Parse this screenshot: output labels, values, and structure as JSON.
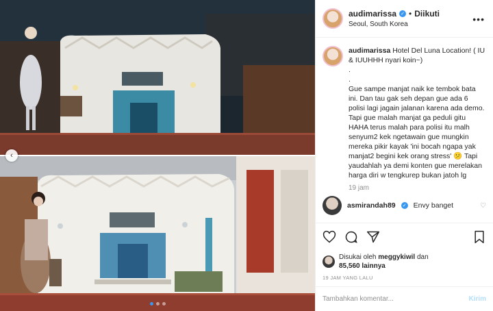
{
  "header": {
    "username": "audimarissa",
    "separator": "•",
    "follow_label": "Diikuti",
    "location": "Seoul, South Korea",
    "more_icon": "more-horizontal-icon"
  },
  "caption": {
    "username": "audimarissa",
    "text": "Hotel Del Luna Location! ( IU & IUUHHH nyari koin~)\n.\n.\nGue sampe manjat naik ke tembok bata ini. Dan tau gak seh depan gue ada 6 polisi lagi jagain jalanan karena ada demo. Tapi gue malah manjat ga peduli gitu HAHA terus malah para polisi itu malh senyum2 kek ngetawain gue mungkin mereka pikir kayak 'ini bocah ngapa yak manjat2 begini kek orang stress' 😕 Tapi yaudahlah ya demi konten gue merelakan harga diri w tengkurep bukan jatoh lg",
    "time": "19 jam"
  },
  "comments": [
    {
      "username": "asmirandah89",
      "text": "Envy banget"
    }
  ],
  "actions": {
    "like_icon": "heart-icon",
    "comment_icon": "comment-icon",
    "share_icon": "share-icon",
    "save_icon": "bookmark-icon"
  },
  "likes": {
    "prefix": "Disukai oleh",
    "liker": "meggykiwil",
    "conj": "dan",
    "count": "85,560 lainnya"
  },
  "posted_ago": "19 JAM YANG LALU",
  "comment_input": {
    "placeholder": "Tambahkan komentar...",
    "post_label": "Kirim"
  },
  "colors": {
    "accent": "#3897f0",
    "muted": "#8e8e8e",
    "post_disabled": "#b2dffc"
  },
  "carousel": {
    "total": 3,
    "active": 1
  }
}
